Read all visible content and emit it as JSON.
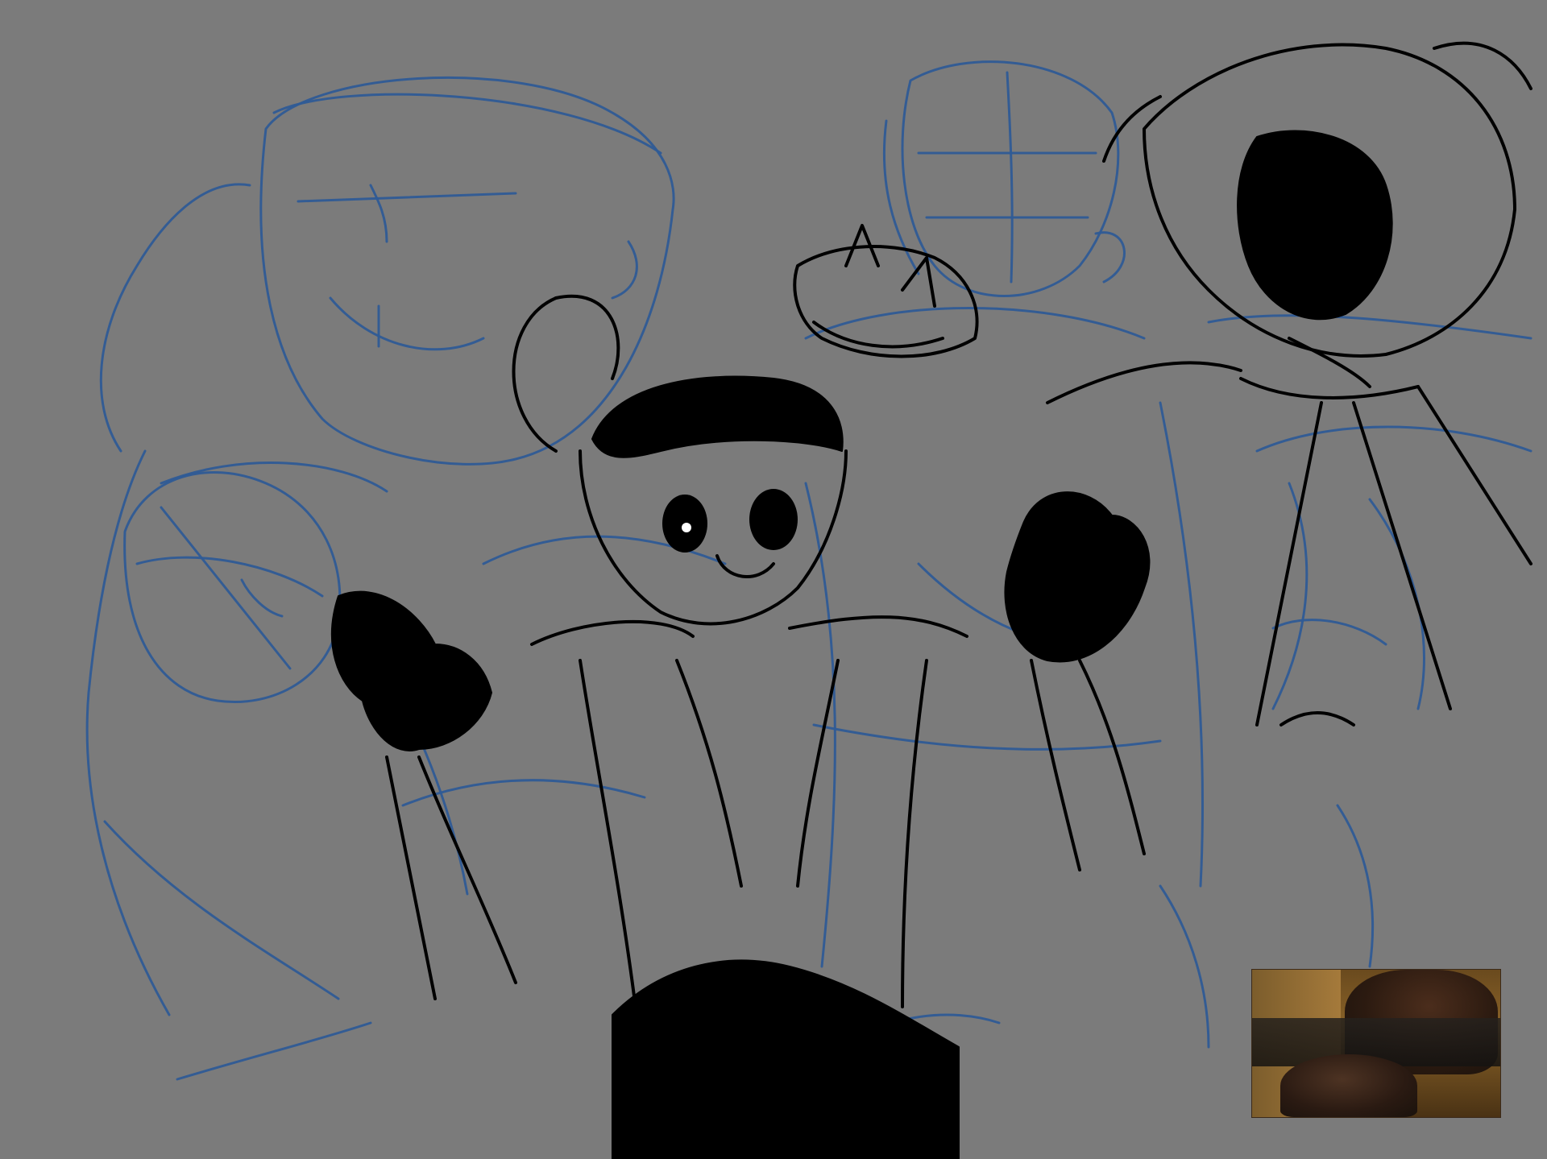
{
  "canvas": {
    "background_color": "#7b7b7b",
    "sketch_line_color": "#2f5b96",
    "ink_color": "#000000"
  },
  "layers": [
    {
      "name": "blue-construction-sketch"
    },
    {
      "name": "black-ink-figures"
    },
    {
      "name": "reference-photo-thumbnail"
    }
  ]
}
